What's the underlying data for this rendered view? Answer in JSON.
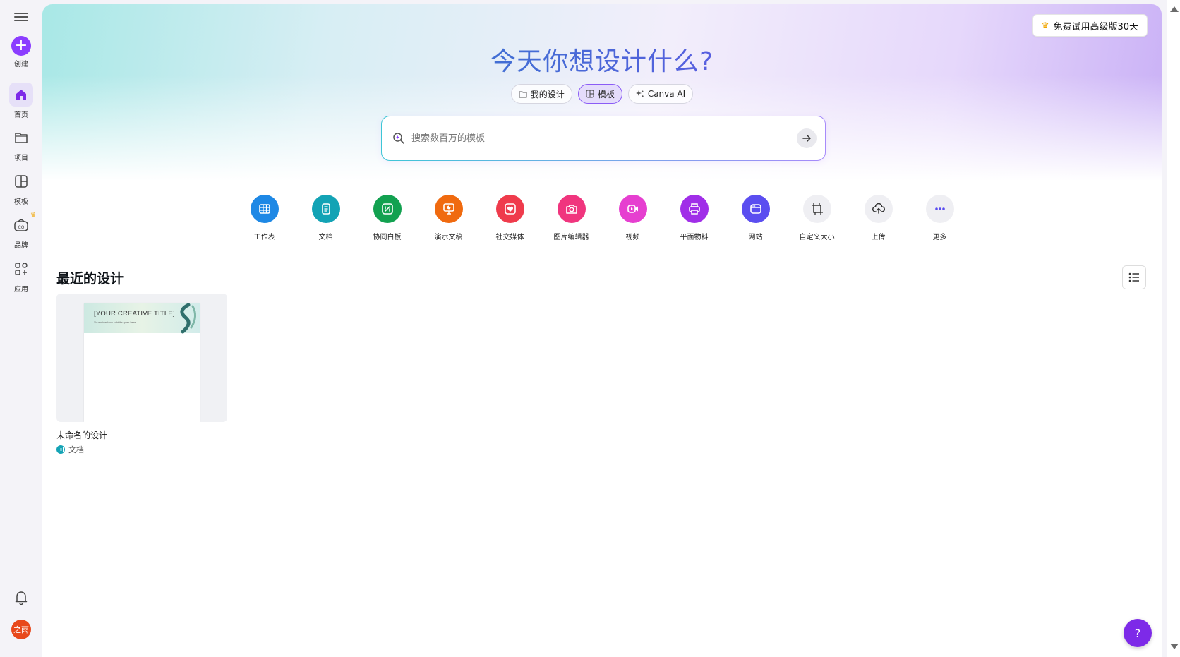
{
  "sidebar": {
    "create_label": "创建",
    "items": [
      {
        "label": "首页",
        "icon": "home-icon"
      },
      {
        "label": "项目",
        "icon": "folder-icon"
      },
      {
        "label": "模板",
        "icon": "template-icon"
      },
      {
        "label": "品牌",
        "icon": "brand-icon"
      },
      {
        "label": "应用",
        "icon": "apps-icon"
      }
    ],
    "avatar_text": "之雨"
  },
  "header": {
    "trial_label": "免费试用高级版30天",
    "title": "今天你想设计什么?"
  },
  "tabs": [
    {
      "label": "我的设计",
      "icon": "folder-icon"
    },
    {
      "label": "模板",
      "icon": "template-icon"
    },
    {
      "label": "Canva AI",
      "icon": "sparkle-icon"
    }
  ],
  "search": {
    "placeholder": "搜索数百万的模板"
  },
  "categories": [
    {
      "label": "工作表",
      "color": "#1e88e5",
      "icon": "sheet-icon"
    },
    {
      "label": "文档",
      "color": "#13a3b5",
      "icon": "doc-icon"
    },
    {
      "label": "协同白板",
      "color": "#12a150",
      "icon": "whiteboard-icon"
    },
    {
      "label": "演示文稿",
      "color": "#f06a0f",
      "icon": "presentation-icon"
    },
    {
      "label": "社交媒体",
      "color": "#ef3b4c",
      "icon": "heart-icon"
    },
    {
      "label": "图片编辑器",
      "color": "#f0357e",
      "icon": "camera-icon"
    },
    {
      "label": "视频",
      "color": "#e63fd0",
      "icon": "video-icon"
    },
    {
      "label": "平面物料",
      "color": "#a02ee8",
      "icon": "print-icon"
    },
    {
      "label": "网站",
      "color": "#5b4ef0",
      "icon": "website-icon"
    },
    {
      "label": "自定义大小",
      "color": "#efeff3",
      "icon": "resize-icon"
    },
    {
      "label": "上传",
      "color": "#efeff3",
      "icon": "upload-icon"
    },
    {
      "label": "更多",
      "color": "#efeff3",
      "icon": "more-icon"
    }
  ],
  "recent": {
    "title": "最近的设计",
    "designs": [
      {
        "name": "未命名的设计",
        "type": "文档",
        "thumb_title": "[YOUR CREATIVE TITLE]",
        "thumb_subtitle": "Your slideshow subtitle goes here"
      }
    ]
  },
  "help_label": "?",
  "colors": {
    "accent": "#8b3dff",
    "doc": "#13a3b5"
  }
}
